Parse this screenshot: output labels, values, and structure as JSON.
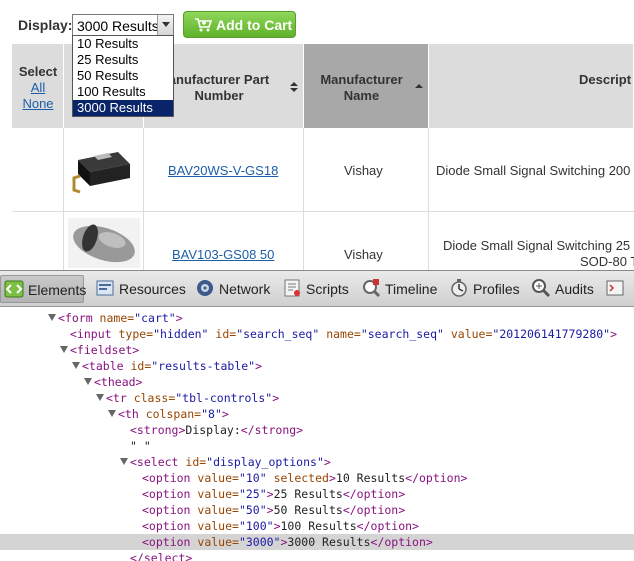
{
  "webpage": {
    "display_label": "Display:",
    "display_value": "3000 Results",
    "add_to_cart": "Add to Cart",
    "dropdown_options": [
      "10 Results",
      "25 Results",
      "50 Results",
      "100 Results",
      "3000 Results"
    ],
    "selected_option": "3000 Results",
    "headers": {
      "select": "Select",
      "all": "All",
      "none": "None",
      "mpn_line1": "anufacturer Part",
      "mpn_line2": "Number",
      "mfr_line1": "Manufacturer",
      "mfr_line2": "Name",
      "desc": "Descript"
    },
    "rows": [
      {
        "part": "BAV20WS-V-GS18",
        "manufacturer": "Vishay",
        "description": "Diode Small Signal Switching 200"
      },
      {
        "part": "BAV103-GS08 50",
        "manufacturer": "Vishay",
        "description_line1": "Diode Small Signal Switching 25",
        "description_line2": "SOD-80 T"
      }
    ]
  },
  "devtools": {
    "tabs": [
      "Elements",
      "Resources",
      "Network",
      "Scripts",
      "Timeline",
      "Profiles",
      "Audits"
    ],
    "active_tab": "Elements",
    "dom": {
      "l1": {
        "open": "<form",
        "attr1": " name=",
        "val1": "\"cart\"",
        "close": ">"
      },
      "l2": {
        "open": "<input",
        "a1": " type=",
        "v1": "\"hidden\"",
        "a2": " id=",
        "v2": "\"search_seq\"",
        "a3": " name=",
        "v3": "\"search_seq\"",
        "a4": " value=",
        "v4": "\"201206141779280\"",
        "close": ">"
      },
      "l3": {
        "text": "<fieldset>"
      },
      "l4": {
        "open": "<table",
        "a1": " id=",
        "v1": "\"results-table\"",
        "close": ">"
      },
      "l5": {
        "text": "<thead>"
      },
      "l6": {
        "open": "<tr",
        "a1": " class=",
        "v1": "\"tbl-controls\"",
        "close": ">"
      },
      "l7": {
        "open": "<th",
        "a1": " colspan=",
        "v1": "\"8\"",
        "close": ">"
      },
      "l8": {
        "open": "<strong>",
        "text": "Display:",
        "close": "</strong>"
      },
      "l9": {
        "text": "\" \""
      },
      "l10": {
        "open": "<select",
        "a1": " id=",
        "v1": "\"display_options\"",
        "close": ">"
      },
      "opts": [
        {
          "open": "<option",
          "a1": " value=",
          "v1": "\"10\"",
          "extra": " selected",
          "close": ">",
          "text": "10 Results",
          "end": "</option>"
        },
        {
          "open": "<option",
          "a1": " value=",
          "v1": "\"25\"",
          "extra": "",
          "close": ">",
          "text": "25 Results",
          "end": "</option>"
        },
        {
          "open": "<option",
          "a1": " value=",
          "v1": "\"50\"",
          "extra": "",
          "close": ">",
          "text": "50 Results",
          "end": "</option>"
        },
        {
          "open": "<option",
          "a1": " value=",
          "v1": "\"100\"",
          "extra": "",
          "close": ">",
          "text": "100 Results",
          "end": "</option>"
        },
        {
          "open": "<option",
          "a1": " value=",
          "v1": "\"3000\"",
          "extra": "",
          "close": ">",
          "text": "3000 Results",
          "end": "</option>"
        }
      ],
      "l_end": {
        "text": "</select>"
      }
    }
  }
}
